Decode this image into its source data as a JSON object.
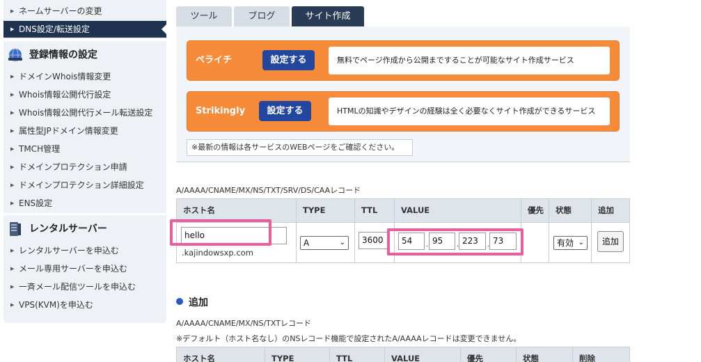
{
  "sidebar": {
    "top_items": [
      {
        "label": "ネームサーバーの変更"
      },
      {
        "label": "DNS設定/転送設定"
      }
    ],
    "registration_heading": "登録情報の設定",
    "registration_items": [
      {
        "label": "ドメインWhois情報変更"
      },
      {
        "label": "Whois情報公開代行設定"
      },
      {
        "label": "Whois情報公開代行メール転送設定"
      },
      {
        "label": "属性型JPドメイン情報変更"
      },
      {
        "label": "TMCH管理"
      },
      {
        "label": "ドメインプロテクション申請"
      },
      {
        "label": "ドメインプロテクション詳細設定"
      },
      {
        "label": "ENS設定"
      }
    ],
    "rental_heading": "レンタルサーバー",
    "rental_items": [
      {
        "label": "レンタルサーバーを申込む"
      },
      {
        "label": "メール専用サーバーを申込む"
      },
      {
        "label": "一斉メール配信ツールを申込む"
      },
      {
        "label": "VPS(KVM)を申込む"
      }
    ]
  },
  "tabs": [
    {
      "label": "ツール"
    },
    {
      "label": "ブログ"
    },
    {
      "label": "サイト作成"
    }
  ],
  "services": [
    {
      "name": "ペライチ",
      "button": "設定する",
      "description": "無料でページ作成から公開まですることが可能なサイト作成サービス"
    },
    {
      "name": "Strikingly",
      "button": "設定する",
      "description": "HTMLの知識やデザインの経験は全く必要なくサイト作成ができるサービス"
    }
  ],
  "notice": "※最新の情報は各サービスのWEBページをご確認ください。",
  "record_section": {
    "caption": "A/AAAA/CNAME/MX/NS/TXT/SRV/DS/CAAレコード",
    "columns": [
      "ホスト名",
      "TYPE",
      "TTL",
      "VALUE",
      "優先",
      "状態",
      "追加"
    ],
    "row": {
      "host_value": "hello",
      "domain_suffix": ".kajindowsxp.com",
      "type_value": "A",
      "ttl_value": "3600",
      "ip_octets": [
        "54",
        "95",
        "223",
        "73"
      ],
      "priority": "",
      "status_value": "有効",
      "add_button": "追加"
    }
  },
  "added_section": {
    "heading": "追加",
    "caption": "A/AAAA/CNAME/MX/NS/TXTレコード",
    "note": "※デフォルト（ホスト名なし）のNSレコード機能で設定されたA/AAAAレコードは変更できません。",
    "columns": [
      "ホスト名",
      "TYPE",
      "TTL",
      "VALUE",
      "優先",
      "状態",
      "削除"
    ]
  },
  "colors": {
    "sidebar_active": "#1f3350",
    "service_orange": "#f68b3a",
    "service_button": "#23479e",
    "highlight": "#ea5d9f",
    "heading_dot": "#2a58c6"
  }
}
